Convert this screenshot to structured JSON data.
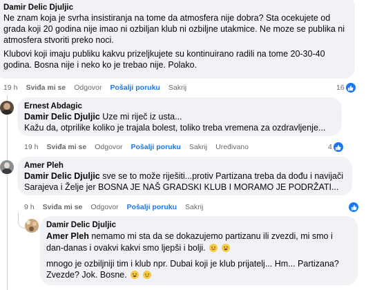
{
  "comment1": {
    "author": "Damir Delic Djuljic",
    "paragraph1": "Ne znam koja je svrha insistiranja na tome da atmosfera nije dobra? Sta ocekujete od grada koji 20 godina nije imao ni ozbiljan klub ni ozbiljne utakmice. Ne moze se publika ni atmosfera stvoriti preko noci.",
    "paragraph2": "Klubovi koji imaju publiku kakvu prizeljkujete su kontinuirano radili na tome 20-30-40 godina. Bosna nije i neko ko je trebao nije. Polako.",
    "time": "19 h",
    "like_label": "Sviđa mi se",
    "reply_label": "Odgovor",
    "send_label": "Pošalji poruku",
    "hide_label": "Sakrij",
    "reaction_count": "16"
  },
  "comment2": {
    "author": "Ernest Abdagic",
    "mention": "Damir Delic Djuljic",
    "line1": " Uze mi riječ iz usta...",
    "line2": "Kažu da, otprilike koliko je trajala bolest, toliko treba vremena za ozdravljenje...",
    "time": "19 h",
    "like_label": "Sviđa mi se",
    "reply_label": "Odgovor",
    "send_label": "Pošalji poruku",
    "hide_label": "Sakrij",
    "edited_label": "Uređivano",
    "reaction_count": "4"
  },
  "comment3": {
    "author": "Amer Pleh",
    "mention": "Damir Delic Djuljic",
    "line1": " sve se to može riješiti...protiv Partizana treba da dođu i navijači",
    "line2": "Sarajeva i Želje jer BOSNA JE NAŠ GRADSKI KLUB I MORAMO JE PODRŽATI...",
    "time": "9 h",
    "like_label": "Sviđa mi se",
    "reply_label": "Odgovor",
    "send_label": "Pošalji poruku",
    "hide_label": "Sakrij"
  },
  "comment4": {
    "author": "Damir Delic Djuljic",
    "mention": "Amer Pleh",
    "line1": " nemamo mi sta da se dokazujemo partizanu ili zvezdi, mi smo i",
    "line2": "dan-danas i ovakvi kakvi smo ljepši i bolji.",
    "line3": "mnogo je ozbiljniji tim i klub npr. Dubai koji je klub prijatelj... Hm... Partizana?",
    "line4": "Zvezde? Jok. Bosne."
  },
  "colors": {
    "accent": "#1877f2",
    "bubble": "#f0f2f5",
    "muted": "#65676b"
  },
  "icons": [
    "like-icon",
    "avatar-ernest",
    "avatar-amer",
    "avatar-damir",
    "emoji-smile",
    "emoji-grin"
  ]
}
